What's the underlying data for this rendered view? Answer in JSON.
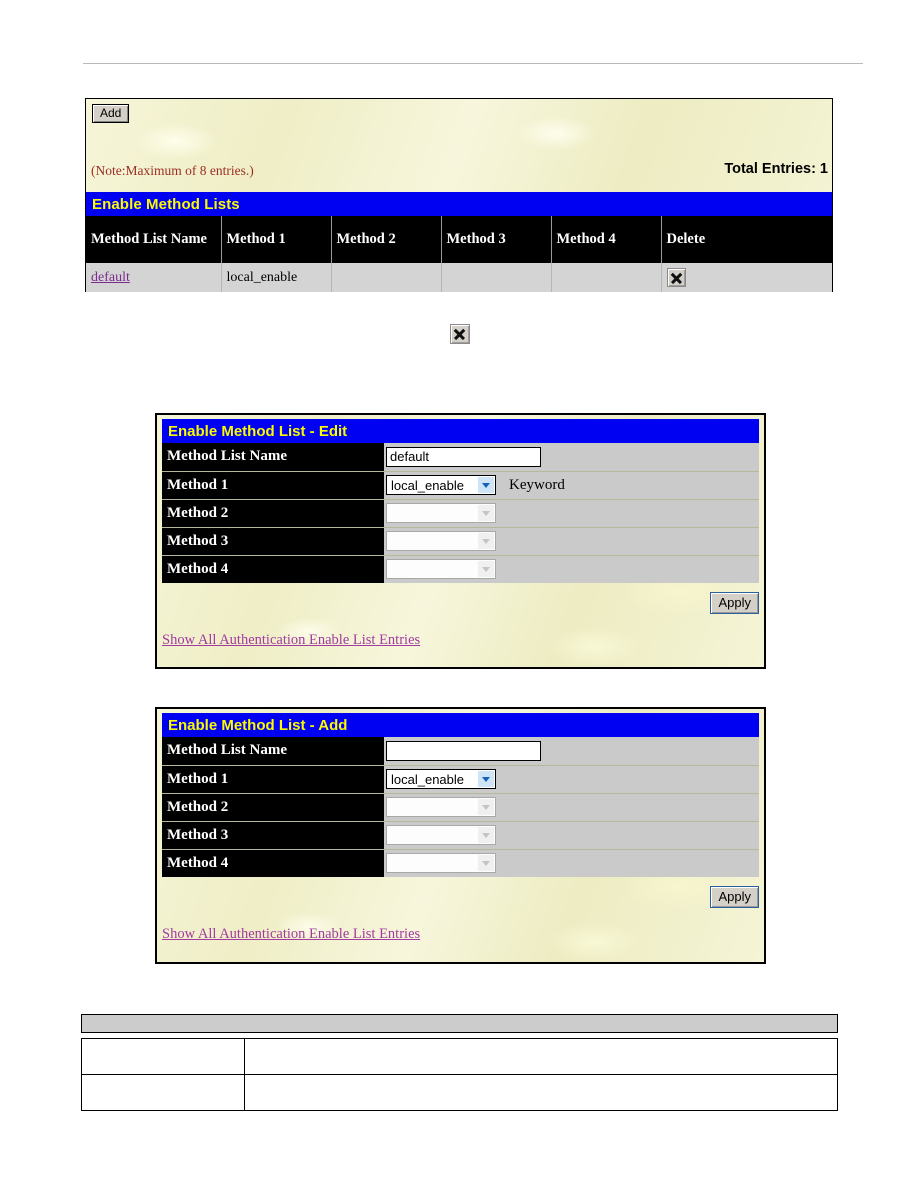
{
  "page": {
    "background_color": "#ffffff",
    "panel_cream": "#f3f2ce",
    "accent_blue": "#0000f2",
    "accent_yellow": "#fbfb00",
    "note_color": "#9c2f24",
    "link_color": "#a23ba0"
  },
  "list_panel": {
    "add_button": "Add",
    "note": "(Note:Maximum of 8 entries.)",
    "total_entries": "Total Entries: 1",
    "title": "Enable Method Lists",
    "columns": [
      "Method List Name",
      "Method 1",
      "Method 2",
      "Method 3",
      "Method 4",
      "Delete"
    ],
    "rows": [
      {
        "name": "default",
        "method1": "local_enable",
        "method2": "",
        "method3": "",
        "method4": "",
        "delete_icon": "close-x-icon"
      }
    ]
  },
  "mid_icon": {
    "name": "close-x-icon"
  },
  "edit_panel": {
    "title": "Enable Method List - Edit",
    "fields": [
      {
        "label": "Method List Name",
        "control": "text",
        "value": "default",
        "placeholder": "",
        "disabled": false,
        "suffix": ""
      },
      {
        "label": "Method 1",
        "control": "select",
        "value": "local_enable",
        "disabled": false,
        "suffix": "Keyword"
      },
      {
        "label": "Method 2",
        "control": "select",
        "value": "",
        "disabled": true,
        "suffix": ""
      },
      {
        "label": "Method 3",
        "control": "select",
        "value": "",
        "disabled": true,
        "suffix": ""
      },
      {
        "label": "Method 4",
        "control": "select",
        "value": "",
        "disabled": true,
        "suffix": ""
      }
    ],
    "apply_label": "Apply",
    "show_all_link": "Show All Authentication Enable List Entries"
  },
  "add_panel": {
    "title": "Enable Method List - Add",
    "fields": [
      {
        "label": "Method List Name",
        "control": "text",
        "value": "",
        "placeholder": "",
        "disabled": false,
        "suffix": ""
      },
      {
        "label": "Method 1",
        "control": "select",
        "value": "local_enable",
        "disabled": false,
        "suffix": ""
      },
      {
        "label": "Method 2",
        "control": "select",
        "value": "",
        "disabled": true,
        "suffix": ""
      },
      {
        "label": "Method 3",
        "control": "select",
        "value": "",
        "disabled": true,
        "suffix": ""
      },
      {
        "label": "Method 4",
        "control": "select",
        "value": "",
        "disabled": true,
        "suffix": ""
      }
    ],
    "apply_label": "Apply",
    "show_all_link": "Show All Authentication Enable List Entries"
  },
  "description_table": {
    "header": "",
    "rows": [
      {
        "parameter": "",
        "description": ""
      },
      {
        "parameter": "",
        "description": ""
      }
    ]
  }
}
